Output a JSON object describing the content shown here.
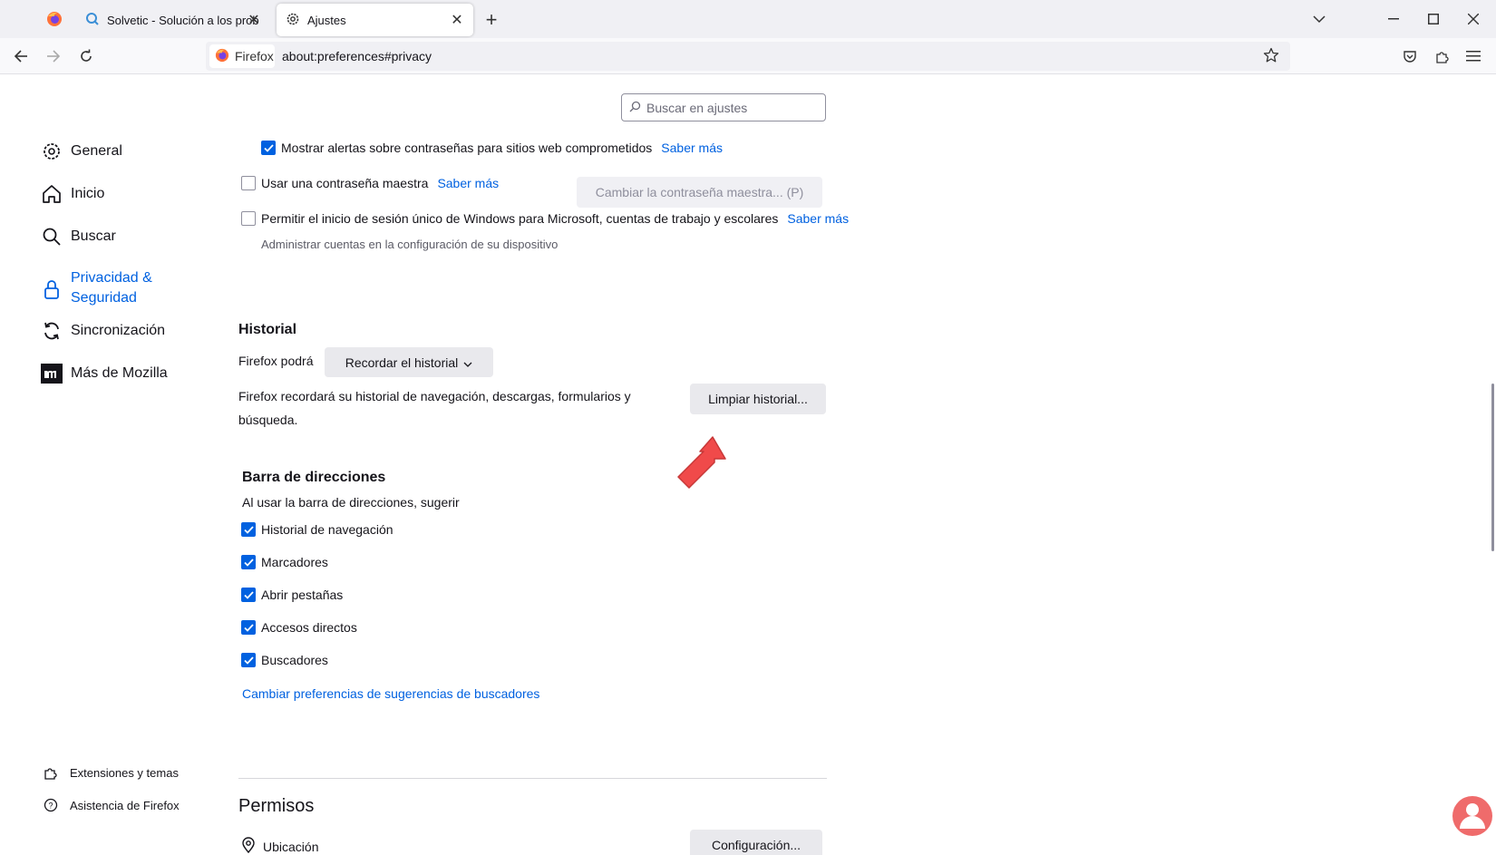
{
  "tabs": [
    {
      "label": ""
    },
    {
      "label": "Solvetic - Solución a los problem"
    },
    {
      "label": "Ajustes"
    }
  ],
  "nav": {
    "identity_label": "Firefox",
    "url": "about:preferences#privacy"
  },
  "search": {
    "placeholder": "Buscar en ajustes"
  },
  "sidebar": {
    "items": [
      {
        "label": "General",
        "icon": "gear-icon"
      },
      {
        "label": "Inicio",
        "icon": "home-icon"
      },
      {
        "label": "Buscar",
        "icon": "search-icon"
      },
      {
        "label": "Privacidad & Seguridad",
        "label_line1": "Privacidad &",
        "label_line2": "Seguridad",
        "icon": "lock-icon",
        "active": true
      },
      {
        "label": "Sincronización",
        "icon": "sync-icon"
      },
      {
        "label": "Más de Mozilla",
        "icon": "mozilla-icon"
      }
    ],
    "footer": [
      {
        "label": "Extensiones y temas",
        "icon": "puzzle-icon"
      },
      {
        "label": "Asistencia de Firefox",
        "icon": "help-icon"
      }
    ]
  },
  "logins": {
    "breach_alerts": {
      "label": "Mostrar alertas sobre contraseñas para sitios web comprometidos",
      "checked": true,
      "link": "Saber más"
    },
    "master_password": {
      "label": "Usar una contraseña maestra",
      "checked": false,
      "link": "Saber más",
      "button": "Cambiar la contraseña maestra... (P)"
    },
    "windows_sso": {
      "label": "Permitir el inicio de sesión único de Windows para Microsoft, cuentas de trabajo y escolares",
      "checked": false,
      "link": "Saber más",
      "note": "Administrar cuentas en la configuración de su dispositivo"
    }
  },
  "history": {
    "title": "Historial",
    "mode_label": "Firefox podrá",
    "mode_value": "Recordar el historial",
    "description_line1": "Firefox recordará su historial de navegación, descargas, formularios y",
    "description_line2": "búsqueda.",
    "clear_button": "Limpiar historial..."
  },
  "address_bar": {
    "title": "Barra de direcciones",
    "subtitle": "Al usar la barra de direcciones, sugerir",
    "options": [
      {
        "label": "Historial de navegación",
        "checked": true
      },
      {
        "label": "Marcadores",
        "checked": true
      },
      {
        "label": "Abrir pestañas",
        "checked": true
      },
      {
        "label": "Accesos directos",
        "checked": true
      },
      {
        "label": "Buscadores",
        "checked": true
      }
    ],
    "link": "Cambiar preferencias de sugerencias de buscadores"
  },
  "permissions": {
    "title": "Permisos",
    "location_label": "Ubicación",
    "location_button": "Configuración..."
  },
  "colors": {
    "accent": "#0061e0",
    "arrow": "#f04a4a"
  }
}
